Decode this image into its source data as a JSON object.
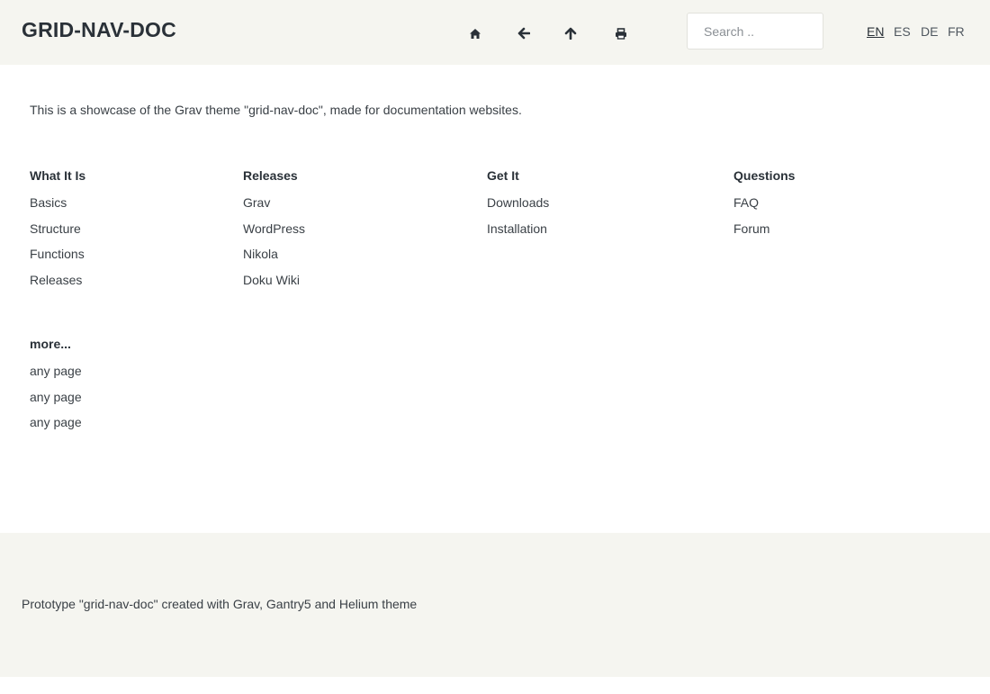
{
  "header": {
    "site_title": "GRID-NAV-DOC",
    "icons": [
      "home-icon",
      "arrow-left-icon",
      "arrow-up-icon",
      "print-icon"
    ],
    "search_placeholder": "Search ..",
    "languages": [
      "EN",
      "ES",
      "DE",
      "FR"
    ],
    "active_language": "EN"
  },
  "main": {
    "intro": "This is a showcase of the Grav theme \"grid-nav-doc\", made for documentation websites.",
    "columns": [
      {
        "title": "What It Is",
        "links": [
          "Basics",
          "Structure",
          "Functions",
          "Releases"
        ]
      },
      {
        "title": "Releases",
        "links": [
          "Grav",
          "WordPress",
          "Nikola",
          "Doku Wiki"
        ]
      },
      {
        "title": "Get It",
        "links": [
          "Downloads",
          "Installation"
        ]
      },
      {
        "title": "Questions",
        "links": [
          "FAQ",
          "Forum"
        ]
      },
      {
        "title": "more...",
        "links": [
          "any page",
          "any page",
          "any page"
        ]
      }
    ]
  },
  "footer": {
    "text": "Prototype \"grid-nav-doc\" created with Grav, Gantry5 and Helium theme"
  },
  "colors": {
    "header_bg": "#f5f5f0",
    "text": "#2d3338"
  }
}
